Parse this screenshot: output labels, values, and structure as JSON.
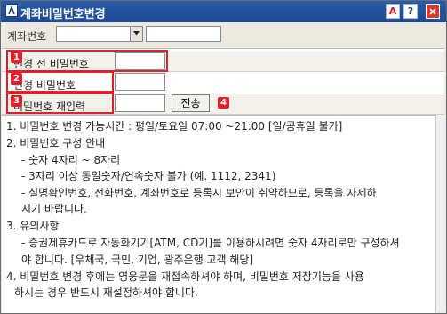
{
  "window": {
    "title": "계좌비밀번호변경",
    "buttons": {
      "a": "A",
      "help": "?"
    }
  },
  "account": {
    "label": "계좌번호",
    "selected": "",
    "name": ""
  },
  "form": {
    "rows": [
      {
        "badge": "1",
        "label": "변경 전 비밀번호",
        "value": ""
      },
      {
        "badge": "2",
        "label": "변경 비밀번호",
        "value": ""
      },
      {
        "badge": "3",
        "label": "비밀번호 재입력",
        "value": ""
      }
    ],
    "send_label": "전송",
    "send_badge": "4"
  },
  "notes": [
    "1. 비밀번호 변경 가능시간 : 평일/토요일 07:00 ~21:00 [일/공휴일 불가]",
    "2. 비밀번호 구성 안내",
    "   - 숫자 4자리 ~ 8자리",
    "   - 3자리 이상 동일숫자/연속숫자 불가 (예. 1112, 2341)",
    "   - 실명확인번호, 전화번호, 계좌번호로 등록시 보안이 취약하므로, 등록을 자제하",
    "     시기 바랍니다.",
    "3. 유의사항",
    "   - 증권제휴카드로 자동화기기[ATM, CD기]를 이용하시려면 숫자 4자리로만 구성하셔",
    "     야 합니다. [우체국, 국민, 기업, 광주은행 고객 해당]",
    "4. 비밀번호 변경 후에는 영웅문을 재접속하셔야 하며, 비밀번호 저장기능을 사용",
    "   하시는 경우 반드시 재설정하셔야 합니다."
  ],
  "colors": {
    "titlebar": "#1d4a92",
    "highlight": "#e3202a"
  }
}
